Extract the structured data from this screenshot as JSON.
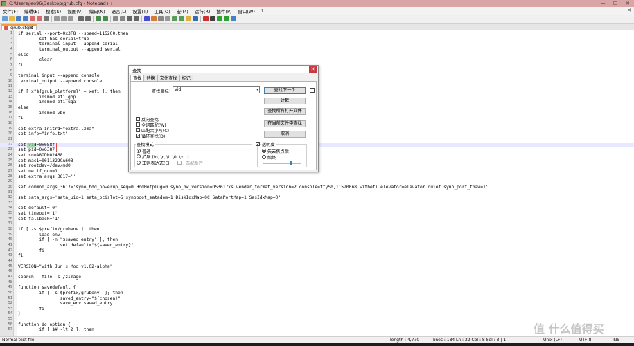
{
  "window": {
    "title": "C:\\Users\\leo96\\Desktop\\grub.cfg - Notepad++",
    "controls": [
      "—",
      "☐",
      "✕"
    ]
  },
  "menu": [
    "文件(F)",
    "编辑(E)",
    "搜索(S)",
    "视图(V)",
    "编码(N)",
    "语言(L)",
    "设置(T)",
    "工具(O)",
    "宏(M)",
    "运行(R)",
    "插件(P)",
    "窗口(W)",
    "?"
  ],
  "menu_close": "✕",
  "toolbar": {
    "icons": [
      "new-file-icon",
      "open-file-icon",
      "save-icon",
      "save-all-icon",
      "close-icon",
      "close-all-icon",
      "print-icon",
      "cut-icon",
      "copy-icon",
      "paste-icon",
      "undo-icon",
      "redo-icon",
      "find-icon",
      "replace-icon",
      "zoom-in-icon",
      "zoom-out-icon",
      "sync-v-icon",
      "sync-h-icon",
      "wrap-icon",
      "all-chars-icon",
      "indent-guide-icon",
      "lang-icon",
      "doc-map-icon",
      "func-list-icon",
      "folder-icon",
      "monitor-icon",
      "record-icon",
      "stop-icon",
      "play-icon",
      "play-multi-icon",
      "save-macro-icon"
    ]
  },
  "tab": {
    "label": "grub.cfg⊠"
  },
  "editor": {
    "lines": [
      {
        "n": "1",
        "t": "if serial --port=0x3F8 --speed=115200;then"
      },
      {
        "n": "2",
        "t": "        set has_serial=true"
      },
      {
        "n": "3",
        "t": "        terminal_input --append serial"
      },
      {
        "n": "4",
        "t": "        terminal_output --append serial"
      },
      {
        "n": "5",
        "t": "else"
      },
      {
        "n": "6",
        "t": "        clear"
      },
      {
        "n": "7",
        "t": "fi"
      },
      {
        "n": "8",
        "t": ""
      },
      {
        "n": "9",
        "t": "terminal_input --append console"
      },
      {
        "n": "10",
        "t": "terminal_output --append console"
      },
      {
        "n": "11",
        "t": ""
      },
      {
        "n": "12",
        "t": "if [ x\"${grub_platform}\" = xefi ]; then"
      },
      {
        "n": "13",
        "t": "        insmod efi_gop"
      },
      {
        "n": "14",
        "t": "        insmod efi_uga"
      },
      {
        "n": "15",
        "t": "else"
      },
      {
        "n": "16",
        "t": "        insmod vbe"
      },
      {
        "n": "17",
        "t": "fi"
      },
      {
        "n": "18",
        "t": ""
      },
      {
        "n": "19",
        "t": "set extra_initrd=\"extra.lzma\""
      },
      {
        "n": "20",
        "t": "set info=\"info.txt\""
      },
      {
        "n": "21",
        "t": ""
      },
      {
        "n": "22",
        "t": "set vid=0x058f"
      },
      {
        "n": "23",
        "t": "set pid=0x6387"
      },
      {
        "n": "24",
        "t": "set sn=A8ODN02468"
      },
      {
        "n": "25",
        "t": "set mac1=0011322CA603"
      },
      {
        "n": "26",
        "t": "set rootdev=/dev/md0"
      },
      {
        "n": "27",
        "t": "set netif_num=1"
      },
      {
        "n": "28",
        "t": "set extra_args_3617=''"
      },
      {
        "n": "29",
        "t": ""
      },
      {
        "n": "30",
        "t": "set common_args_3617='syno_hdd_powerup_seq=0 HddHotplug=0 syno_hw_version=DS3617xs vender_format_version=2 console=ttyS0,115200n8 withefi elevator=elevator quiet syno_port_thaw=1'"
      },
      {
        "n": "31",
        "t": ""
      },
      {
        "n": "32",
        "t": "set sata_args='sata_uid=1 sata_pcislot=5 synoboot_satadom=1 DiskIdxMap=0C SataPortMap=1 SasIdxMap=0'"
      },
      {
        "n": "33",
        "t": ""
      },
      {
        "n": "34",
        "t": "set default='0'"
      },
      {
        "n": "35",
        "t": "set timeout='1'"
      },
      {
        "n": "36",
        "t": "set fallback='1'"
      },
      {
        "n": "37",
        "t": ""
      },
      {
        "n": "38",
        "t": "if [ -s $prefix/grubenv ]; then"
      },
      {
        "n": "39",
        "t": "        load_env"
      },
      {
        "n": "40",
        "t": "        if [ -n \"$saved_entry\" ]; then"
      },
      {
        "n": "41",
        "t": "                set default=\"${saved_entry}\""
      },
      {
        "n": "42",
        "t": "        fi"
      },
      {
        "n": "43",
        "t": "fi"
      },
      {
        "n": "44",
        "t": ""
      },
      {
        "n": "45",
        "t": "VERSION=\"with Jun's Mod v1.02-alpha\""
      },
      {
        "n": "46",
        "t": ""
      },
      {
        "n": "47",
        "t": "search --file -s /zImage"
      },
      {
        "n": "48",
        "t": ""
      },
      {
        "n": "49",
        "t": "function savedefault {"
      },
      {
        "n": "50",
        "t": "        if [ -s $prefix/grubenv  ]; then"
      },
      {
        "n": "51",
        "t": "                saved_entry=\"${chosen}\""
      },
      {
        "n": "52",
        "t": "                save_env saved_entry"
      },
      {
        "n": "53",
        "t": "        fi"
      },
      {
        "n": "54",
        "t": "}"
      },
      {
        "n": "55",
        "t": ""
      },
      {
        "n": "56",
        "t": "function do_option {"
      },
      {
        "n": "57",
        "t": "        if [ $# -lt 2 ]; then"
      }
    ]
  },
  "dialog": {
    "title": "查找",
    "close": "✕",
    "tabs": [
      "查找",
      "替换",
      "文件查找",
      "标记"
    ],
    "find_label": "查找目标：",
    "find_value": "vid",
    "dropdown_arrow": "▾",
    "buttons": {
      "find_next": "查找下一个",
      "count": "计数",
      "find_all_open": "查找所有打开文件",
      "find_all_current": "在当前文件中查找",
      "cancel": "取消"
    },
    "options": {
      "backward": "反向查找",
      "whole_word": "全词匹配(W)",
      "match_case": "匹配大小写(C)",
      "wrap": "循环查找(D)"
    },
    "search_mode": {
      "title": "查找模式",
      "normal": "普通",
      "extended": "扩展 (\\n, \\r, \\t, \\0, \\x...)",
      "regex": "正则表达式(E)",
      "dot_newline": ". 匹配新行"
    },
    "transparency": {
      "title": "透明度",
      "on_lose_focus": "失去焦点后",
      "always": "始终",
      "slider_value": 0.72
    }
  },
  "status": {
    "file_type": "Normal text file",
    "length": "length : 4,770",
    "lines": "lines : 184",
    "position": "Ln : 22   Col : 8   Sel : 3 | 1",
    "eol": "Unix (LF)",
    "encoding": "UTF-8",
    "mode": "INS"
  },
  "watermark": "值 什么值得买"
}
